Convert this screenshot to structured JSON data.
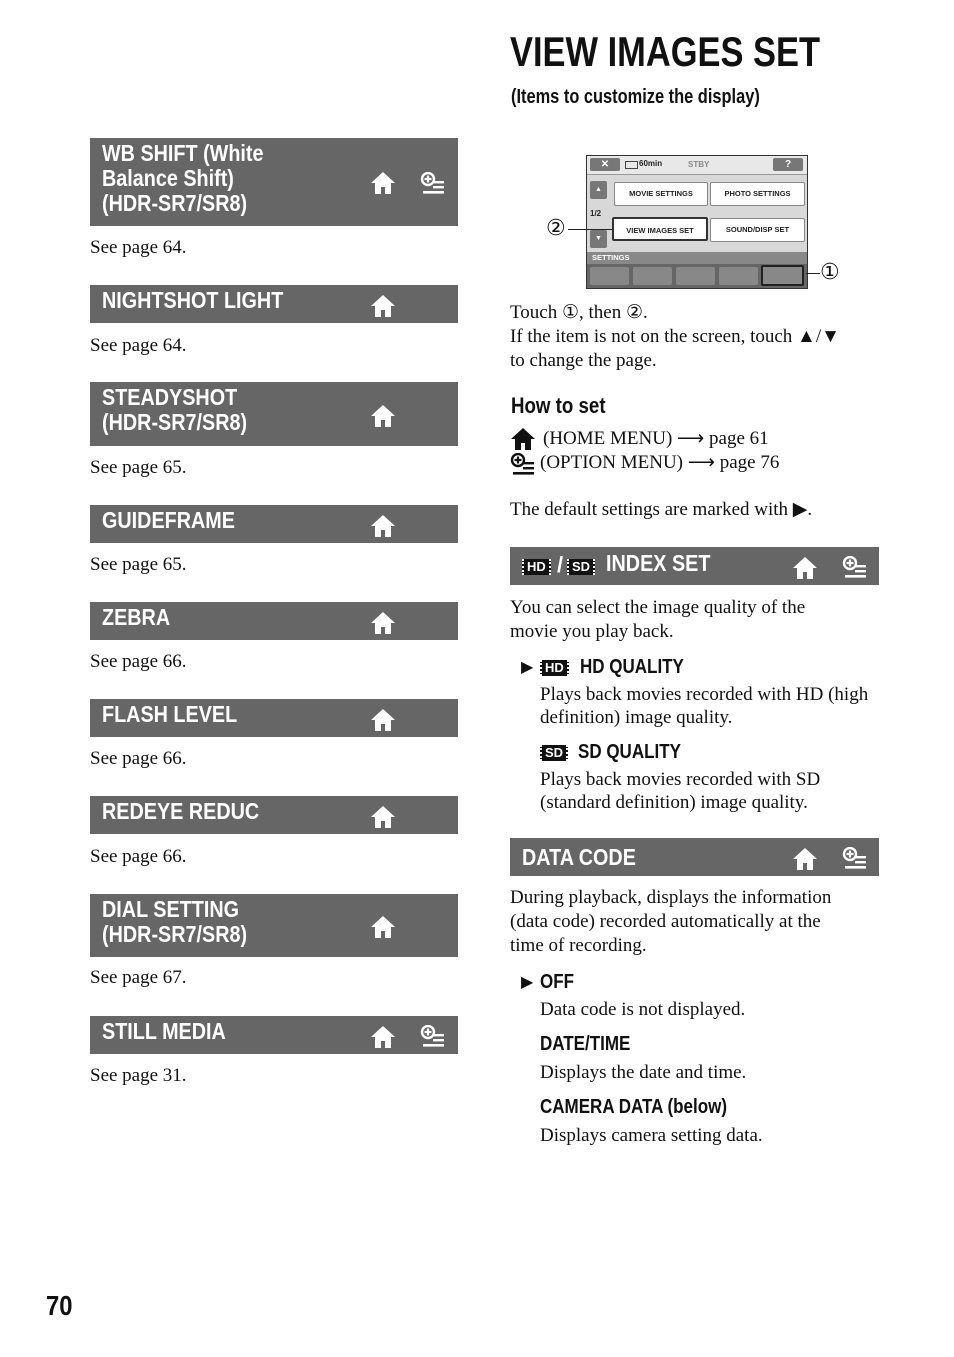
{
  "page": {
    "title": "VIEW IMAGES SET",
    "subtitle": "(Items to customize the display)",
    "page_number": "70"
  },
  "left_items": [
    {
      "title_lines": [
        "WB SHIFT (White",
        "Balance Shift)",
        "(HDR-SR7/SR8)"
      ],
      "home": true,
      "option": true,
      "ref": "See page 64."
    },
    {
      "title_lines": [
        "NIGHTSHOT LIGHT"
      ],
      "home": true,
      "option": false,
      "ref": "See page 64."
    },
    {
      "title_lines": [
        "STEADYSHOT",
        "(HDR-SR7/SR8)"
      ],
      "home": true,
      "option": false,
      "ref": "See page 65."
    },
    {
      "title_lines": [
        "GUIDEFRAME"
      ],
      "home": true,
      "option": false,
      "ref": "See page 65."
    },
    {
      "title_lines": [
        "ZEBRA"
      ],
      "home": true,
      "option": false,
      "ref": "See page 66."
    },
    {
      "title_lines": [
        "FLASH LEVEL"
      ],
      "home": true,
      "option": false,
      "ref": "See page 66."
    },
    {
      "title_lines": [
        "REDEYE REDUC"
      ],
      "home": true,
      "option": false,
      "ref": "See page 66."
    },
    {
      "title_lines": [
        "DIAL SETTING",
        "(HDR-SR7/SR8)"
      ],
      "home": true,
      "option": false,
      "ref": "See page 67."
    },
    {
      "title_lines": [
        "STILL MEDIA"
      ],
      "home": true,
      "option": true,
      "ref": "See page 31."
    }
  ],
  "screen": {
    "close": "✕",
    "battery": "60min",
    "status": "STBY",
    "help": "?",
    "page_indicator": "1/2",
    "buttons": [
      "MOVIE SETTINGS",
      "PHOTO SETTINGS",
      "VIEW IMAGES SET",
      "SOUND/DISP SET"
    ],
    "category": "SETTINGS",
    "callout_1": "①",
    "callout_2": "②"
  },
  "instructions": {
    "line1": "Touch ①, then ②.",
    "line2": "If the item is not on the screen, touch ▲/▼",
    "line3": "to change the page."
  },
  "how_to_set": {
    "heading": "How to set",
    "home_line": "(HOME MENU) ⟶ page 61",
    "option_line": "(OPTION MENU) ⟶ page 76",
    "default_note": "The default settings are marked with ▶."
  },
  "index_set": {
    "title": "INDEX SET",
    "hd_badge": "HD",
    "sd_badge": "SD",
    "desc_lines": [
      "You can select the image quality of the",
      "movie you play back."
    ],
    "options": [
      {
        "default": true,
        "badge": "HD",
        "label": "HD QUALITY",
        "desc_lines": [
          "Plays back movies recorded with HD (high",
          "definition) image quality."
        ]
      },
      {
        "default": false,
        "badge": "SD",
        "label": "SD QUALITY",
        "desc_lines": [
          "Plays back movies recorded with SD",
          "(standard definition) image quality."
        ]
      }
    ]
  },
  "data_code": {
    "title": "DATA CODE",
    "desc_lines": [
      "During playback, displays the information",
      "(data code) recorded automatically at the",
      "time of recording."
    ],
    "options": [
      {
        "default": true,
        "label": "OFF",
        "desc": "Data code is not displayed."
      },
      {
        "default": false,
        "label": "DATE/TIME",
        "desc": "Displays the date and time."
      },
      {
        "default": false,
        "label": "CAMERA DATA (below)",
        "desc": "Displays camera setting data."
      }
    ]
  },
  "markers": {
    "default_arrow": "▶"
  }
}
